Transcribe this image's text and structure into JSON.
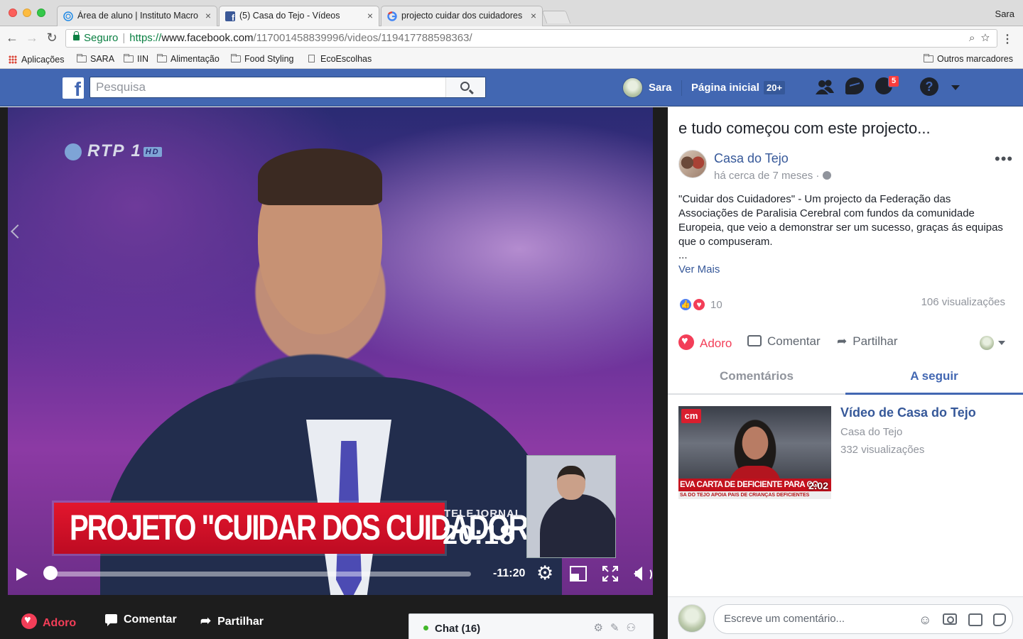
{
  "browser": {
    "tabs": [
      {
        "title": "Área de aluno | Instituto Macro",
        "active": false,
        "icon": "globe-tab-icon"
      },
      {
        "title": "(5) Casa do Tejo - Vídeos",
        "active": true,
        "icon": "facebook-tab-icon"
      },
      {
        "title": "projecto cuidar dos cuidadores",
        "active": false,
        "icon": "google-tab-icon"
      }
    ],
    "profile_name": "Sara",
    "secure_label": "Seguro",
    "url_protocol": "https://",
    "url_host": "www.facebook.com",
    "url_path": "/117001458839996/videos/119417788598363/",
    "bookmarks": [
      "Aplicações",
      "SARA",
      "IIN",
      "Alimentação",
      "Food Styling",
      "EcoEscolhas"
    ],
    "other_bookmarks": "Outros marcadores"
  },
  "fb_header": {
    "logo": "f",
    "search_placeholder": "Pesquisa",
    "user_name": "Sara",
    "home_label": "Página inicial",
    "home_count": "20+",
    "notifications_count": "5",
    "colors": {
      "brand": "#4267b2",
      "badge": "#fa3e3e"
    }
  },
  "video": {
    "channel_logo": "RTP 1",
    "channel_badge": "HD",
    "lower_third": "PROJETO \"CUIDAR DOS CUIDADORES\"",
    "program_label": "TELEJORNAL",
    "program_time": "20:18",
    "time_remaining": "-11:20",
    "progress_fraction": 0.02
  },
  "video_actions": {
    "love": "Adoro",
    "comment": "Comentar",
    "share": "Partilhar"
  },
  "chat": {
    "label": "Chat (16)"
  },
  "post": {
    "title": "e tudo começou com este projecto...",
    "page_name": "Casa do Tejo",
    "time": "há cerca de 7 meses ·",
    "text": "\"Cuidar dos Cuidadores\" - Um projecto da Federação das Associações de Paralisia Cerebral com fundos da comunidade Europeia, que veio a demonstrar ser um sucesso, graças ás equipas que o compuseram.",
    "ellipsis": "...",
    "see_more": "Ver Mais",
    "reactions_count": "10",
    "views": "106 visualizações",
    "actions": {
      "love": "Adoro",
      "comment": "Comentar",
      "share": "Partilhar"
    }
  },
  "tabs": {
    "comments": "Comentários",
    "up_next": "A seguir"
  },
  "related": {
    "title": "Vídeo de Casa do Tejo",
    "page": "Casa do Tejo",
    "views": "332 visualizações",
    "duration": "2:02",
    "thumb_logo": "cm",
    "thumb_caption": "EVA CARTA DE DEFICIENTE PARA CO",
    "thumb_subcaption": "SA DO TEJO APOIA PAIS DE CRIANÇAS DEFICIENTES"
  },
  "comment_box": {
    "placeholder": "Escreve um comentário..."
  }
}
